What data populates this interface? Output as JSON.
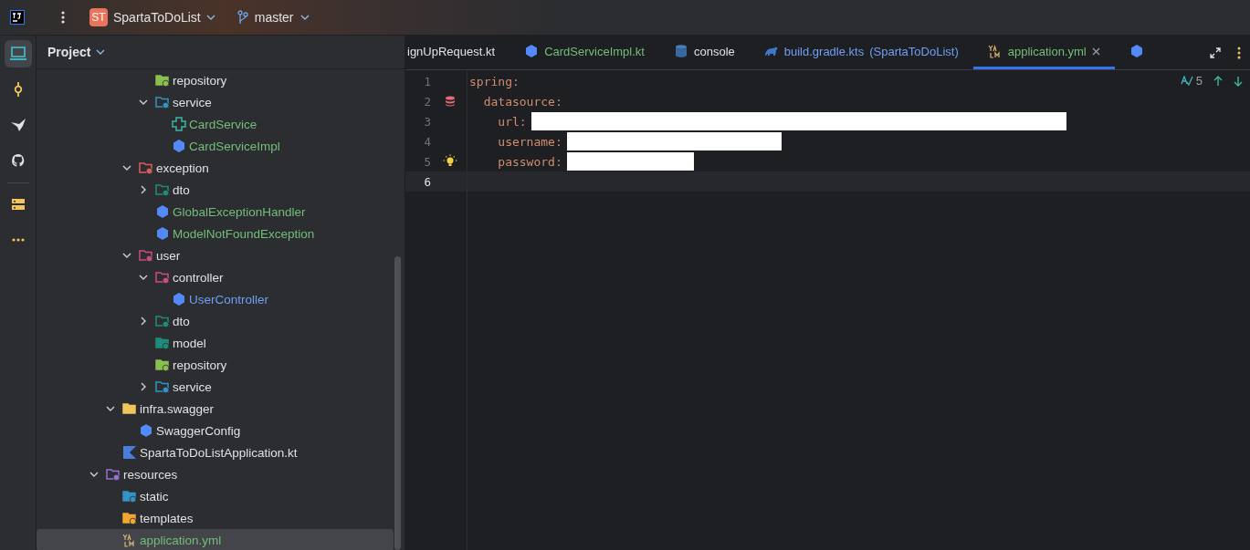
{
  "top_bar": {
    "project_badge": "ST",
    "project_name": "SpartaToDoList",
    "branch": "master"
  },
  "tool_strip": [
    {
      "kind": "project",
      "selected": true
    },
    {
      "kind": "commit",
      "selected": false
    },
    {
      "kind": "build",
      "selected": false
    },
    {
      "kind": "github",
      "selected": false
    },
    {
      "kind": "services",
      "selected": false
    },
    {
      "kind": "more",
      "selected": false
    }
  ],
  "panel": {
    "title": "Project"
  },
  "tree": [
    {
      "children": [
        {
          "children": [
            {
              "children": [
                {
                  "children": [
                    {
                      "label": "repository",
                      "kind": "folder-repo",
                      "selected": false
                    },
                    {
                      "label": "service",
                      "kind": "folder-service",
                      "expanded": true,
                      "selected": false,
                      "children": [
                        {
                          "label": "CardService",
                          "kind": "interface",
                          "color": "#73bd79",
                          "selected": false
                        },
                        {
                          "label": "CardServiceImpl",
                          "kind": "class",
                          "color": "#73bd79",
                          "selected": false
                        }
                      ]
                    }
                  ]
                },
                {
                  "label": "exception",
                  "kind": "folder-exception",
                  "expanded": true,
                  "selected": false,
                  "children": [
                    {
                      "label": "dto",
                      "kind": "folder-dto",
                      "expanded": false,
                      "selected": false
                    },
                    {
                      "label": "GlobalExceptionHandler",
                      "kind": "class",
                      "color": "#73bd79",
                      "selected": false
                    },
                    {
                      "label": "ModelNotFoundException",
                      "kind": "class",
                      "color": "#73bd79",
                      "selected": false
                    }
                  ]
                },
                {
                  "label": "user",
                  "kind": "folder-user",
                  "expanded": true,
                  "selected": false,
                  "children": [
                    {
                      "label": "controller",
                      "kind": "folder-controller",
                      "expanded": true,
                      "selected": false,
                      "children": [
                        {
                          "label": "UserController",
                          "kind": "class",
                          "color": "#6f9ff5",
                          "selected": false
                        }
                      ]
                    },
                    {
                      "label": "dto",
                      "kind": "folder-dto",
                      "expanded": false,
                      "selected": false
                    },
                    {
                      "label": "model",
                      "kind": "folder-model",
                      "selected": false
                    },
                    {
                      "label": "repository",
                      "kind": "folder-repo",
                      "selected": false
                    },
                    {
                      "label": "service",
                      "kind": "folder-service",
                      "expanded": false,
                      "selected": false
                    }
                  ]
                }
              ]
            },
            {
              "label": "infra.swagger",
              "kind": "folder-package",
              "expanded": true,
              "selected": false,
              "children": [
                {
                  "label": "SwaggerConfig",
                  "kind": "class",
                  "selected": false
                }
              ]
            },
            {
              "label": "SpartaToDoListApplication.kt",
              "kind": "kotlin",
              "selected": false
            }
          ]
        },
        {
          "label": "resources",
          "kind": "folder-resources",
          "expanded": true,
          "selected": false,
          "children": [
            {
              "label": "static",
              "kind": "folder-static",
              "selected": false
            },
            {
              "label": "templates",
              "kind": "folder-templates",
              "selected": false
            },
            {
              "label": "application.yml",
              "kind": "yaml",
              "color": "#73bd79",
              "selected": true
            }
          ]
        }
      ]
    }
  ],
  "tabs": [
    {
      "label": "ignUpRequest.kt",
      "selected": false
    },
    {
      "label": "CardServiceImpl.kt",
      "kind": "class",
      "color": "#73bd79",
      "selected": false
    },
    {
      "label": "console",
      "kind": "database",
      "selected": false
    },
    {
      "label": "build.gradle.kts",
      "note": "(SpartaToDoList)",
      "kind": "gradle",
      "color": "#6f9ff5",
      "selected": false
    },
    {
      "label": "application.yml",
      "kind": "yaml",
      "color": "#73bd79",
      "selected": true,
      "closable": true
    },
    {
      "kind": "class",
      "selected": false
    }
  ],
  "inspections": {
    "count": "5"
  },
  "code": [
    {
      "number": "1",
      "text": "spring:",
      "current": false
    },
    {
      "number": "2",
      "text": "  datasource:",
      "kind": "database",
      "current": false
    },
    {
      "number": "3",
      "text": "    url:",
      "redacted": true,
      "current": false
    },
    {
      "number": "4",
      "text": "    username:",
      "redacted": true,
      "current": false
    },
    {
      "number": "5",
      "text": "    password:",
      "kind": "bulb",
      "redacted": true,
      "current": false
    },
    {
      "number": "6",
      "current": true
    }
  ]
}
